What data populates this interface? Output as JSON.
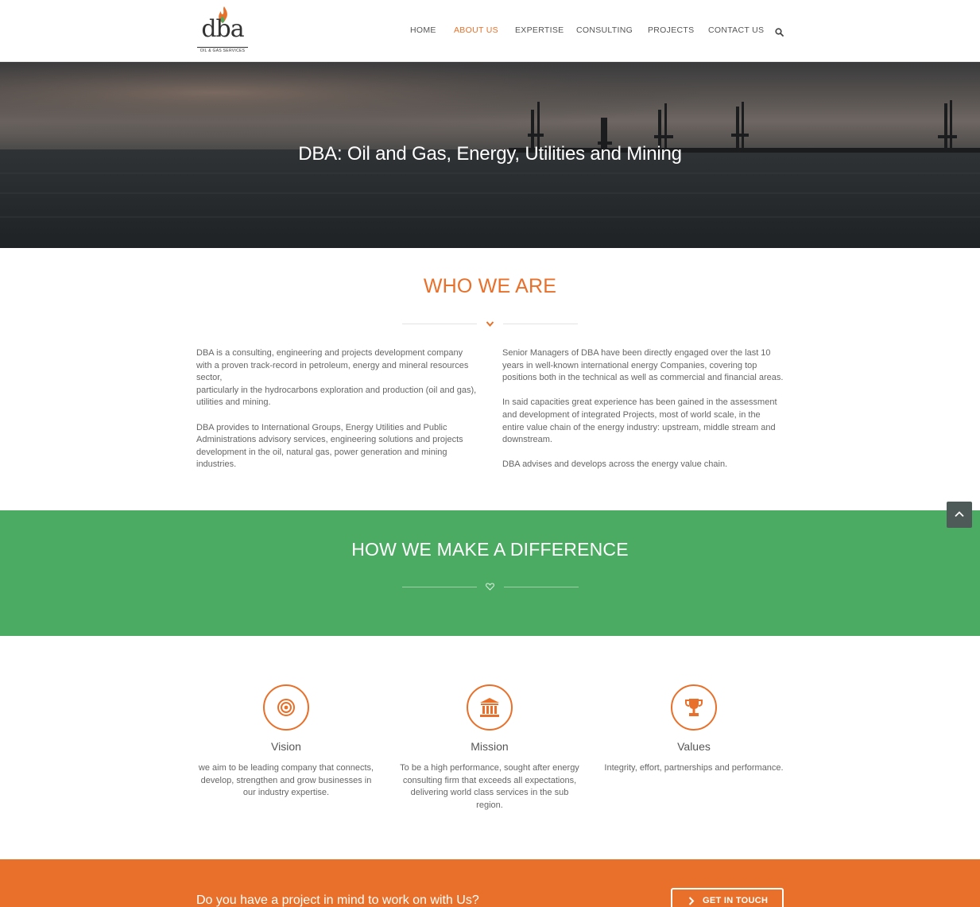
{
  "header": {
    "logo": {
      "text": "dba",
      "subtitle": "OIL & GAS SERVICES"
    },
    "nav": [
      {
        "label": "HOME",
        "active": false
      },
      {
        "label": "ABOUT US",
        "active": true
      },
      {
        "label": "EXPERTISE",
        "active": false
      },
      {
        "label": "CONSULTING",
        "active": false
      },
      {
        "label": "PROJECTS",
        "active": false
      },
      {
        "label": "CONTACT US",
        "active": false
      }
    ],
    "search_icon": "search-icon"
  },
  "hero": {
    "title": "DBA: Oil and Gas, Energy, Utilities and Mining"
  },
  "who_we_are": {
    "title": "WHO WE ARE",
    "divider_icon": "chevron-down-icon",
    "left": {
      "p1": "DBA is a consulting, engineering and projects development company with a proven track-record in petroleum, energy and mineral resources sector,",
      "p1b": "particularly in the hydrocarbons exploration and production (oil and gas), utilities and mining.",
      "p2": "DBA provides to International Groups, Energy Utilities and Public Administrations advisory services, engineering solutions and projects development in the oil, natural gas, power generation and mining industries."
    },
    "right": {
      "p1": "Senior Managers of DBA have been directly engaged over the last 10 years in well-known international energy Companies, covering top positions both in the technical as well as commercial and financial areas.",
      "p2": "In said capacities great experience has been gained in the assessment and development of integrated Projects, most of world scale, in the entire value chain of the energy industry: upstream, middle stream and downstream.",
      "p3": "DBA advises and develops across the energy value chain."
    }
  },
  "difference": {
    "title": "HOW WE MAKE A DIFFERENCE",
    "divider_icon": "heart-icon"
  },
  "features": [
    {
      "icon": "target-icon",
      "title": "Vision",
      "text": "we aim to be leading company that connects, develop, strengthen and grow businesses in our industry expertise."
    },
    {
      "icon": "bank-icon",
      "title": "Mission",
      "text": "To be a high performance, sought after energy consulting firm that exceeds all expectations, delivering world class services in the sub region."
    },
    {
      "icon": "trophy-icon",
      "title": "Values",
      "text": "Integrity, effort, partnerships and performance."
    }
  ],
  "cta": {
    "text": "Do you have a project in mind to work on with Us?",
    "button": "GET IN TOUCH"
  },
  "colors": {
    "accent": "#e8702a",
    "green": "#4cab62",
    "text": "#666666"
  }
}
